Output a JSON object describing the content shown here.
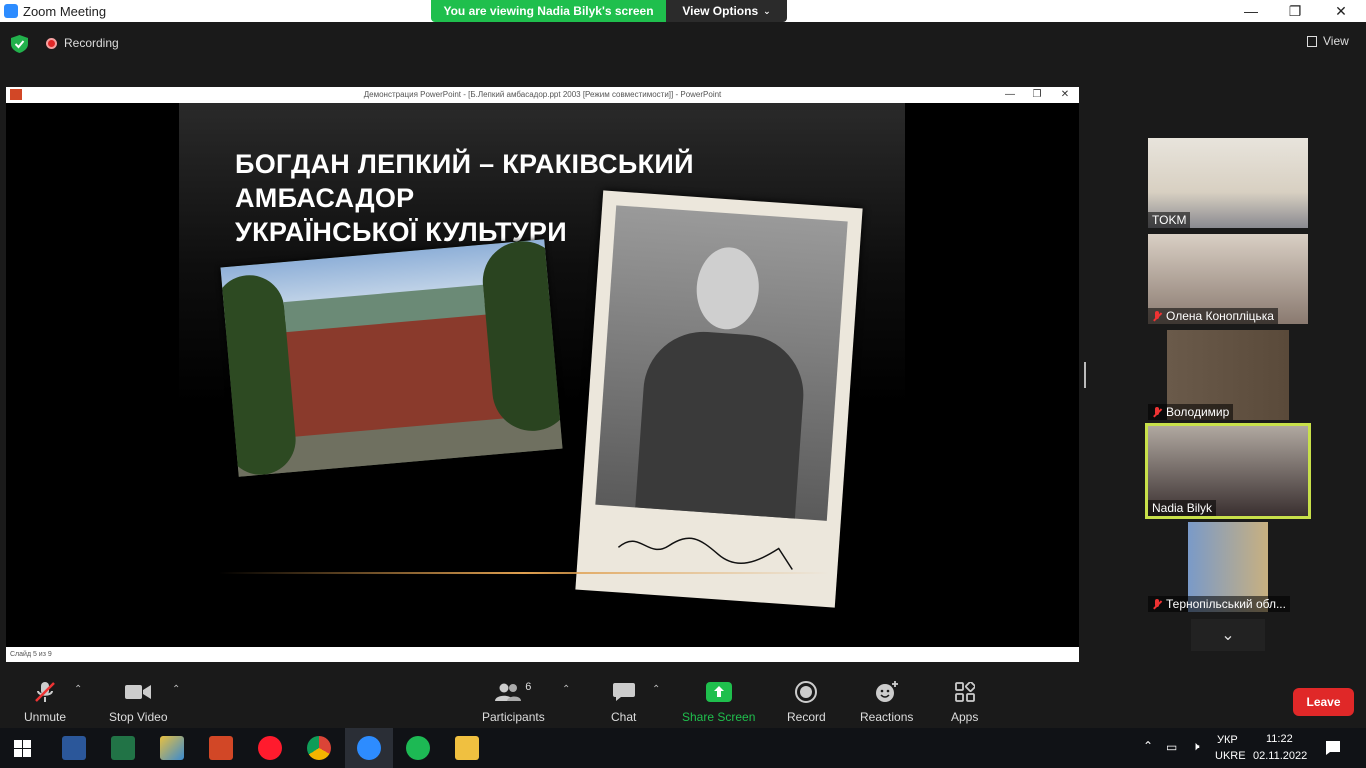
{
  "window": {
    "title": "Zoom Meeting"
  },
  "banner": {
    "viewing": "You are viewing Nadia Bilyk's screen",
    "view_options": "View Options"
  },
  "topbar": {
    "recording": "Recording",
    "view": "View"
  },
  "ppt": {
    "window_title": "Демонстрация PowerPoint - [Б.Лепкий амбасадор.ppt 2003 [Режим совместимости]] - PowerPoint",
    "slide_title_line1": "БОГДАН ЛЕПКИЙ – КРАКІВСЬКИЙ АМБАСАДОР",
    "slide_title_line2": "УКРАЇНСЬКОЇ КУЛЬТУРИ",
    "status": "Слайд 5 из 9"
  },
  "participants_panel": [
    {
      "name": "TOKM",
      "muted": false
    },
    {
      "name": "Олена Конопліцька",
      "muted": true
    },
    {
      "name": "Володимир",
      "muted": true
    },
    {
      "name": "Nadia Bilyk",
      "muted": false,
      "active_speaker": true
    },
    {
      "name": "Тернопільський обл...",
      "muted": true
    }
  ],
  "toolbar": {
    "unmute": "Unmute",
    "stop_video": "Stop Video",
    "participants": "Participants",
    "participants_count": "6",
    "chat": "Chat",
    "share_screen": "Share Screen",
    "record": "Record",
    "reactions": "Reactions",
    "apps": "Apps",
    "leave": "Leave"
  },
  "taskbar": {
    "lang1": "УКР",
    "lang2": "UKRE",
    "time": "11:22",
    "date": "02.11.2022"
  },
  "colors": {
    "share_green": "#1fbf4d",
    "leave_red": "#e02828",
    "active_border": "#c8e04a"
  }
}
